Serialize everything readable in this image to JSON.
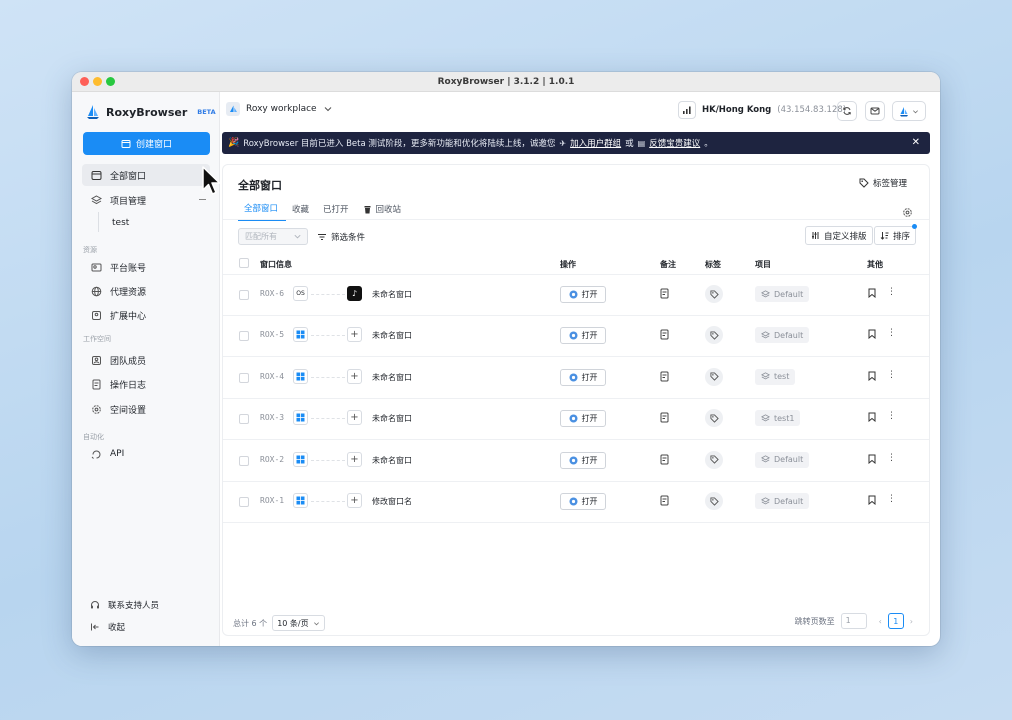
{
  "window": {
    "title": "RoxyBrowser | 3.1.2 | 1.0.1"
  },
  "brand": {
    "name": "RoxyBrowser",
    "badge": "BETA"
  },
  "sidebar": {
    "create_button": "创建窗口",
    "items": [
      {
        "label": "全部窗口"
      },
      {
        "label": "项目管理"
      },
      {
        "label": "平台账号"
      },
      {
        "label": "代理资源"
      },
      {
        "label": "扩展中心"
      },
      {
        "label": "团队成员"
      },
      {
        "label": "操作日志"
      },
      {
        "label": "空间设置"
      },
      {
        "label": "API"
      }
    ],
    "sub_item": "test",
    "sections": [
      "资源",
      "工作空间",
      "自动化"
    ],
    "support": "联系支持人员",
    "collapse": "收起"
  },
  "topbar": {
    "workspace": "Roxy workplace",
    "proxy_location": "HK/Hong Kong",
    "proxy_ip": "(43.154.83.128)"
  },
  "banner": {
    "text": "RoxyBrowser 目前已进入 Beta 测试阶段，更多新功能和优化将陆续上线，诚邀您",
    "link1": "加入用户群组",
    "or": "或",
    "link2": "反馈宝贵建议",
    "end": "。"
  },
  "main": {
    "title": "全部窗口",
    "tag_mgmt": "标签管理",
    "tabs": [
      "全部窗口",
      "收藏",
      "已打开",
      "回收站"
    ],
    "filter_placeholder": "匹配所有",
    "filter_conditions": "筛选条件",
    "custom_columns": "自定义排版",
    "sort": "排序",
    "columns": [
      "窗口信息",
      "操作",
      "备注",
      "标签",
      "项目",
      "其他"
    ],
    "open_label": "打开",
    "rows": [
      {
        "id": "ROX-6",
        "os": "OS",
        "platform": "tiktok",
        "name": "未命名窗口",
        "project": "Default"
      },
      {
        "id": "ROX-5",
        "os": "win",
        "platform": "plus",
        "name": "未命名窗口",
        "project": "Default"
      },
      {
        "id": "ROX-4",
        "os": "win",
        "platform": "plus",
        "name": "未命名窗口",
        "project": "test"
      },
      {
        "id": "ROX-3",
        "os": "win",
        "platform": "plus",
        "name": "未命名窗口",
        "project": "test1"
      },
      {
        "id": "ROX-2",
        "os": "win",
        "platform": "plus",
        "name": "未命名窗口",
        "project": "Default"
      },
      {
        "id": "ROX-1",
        "os": "win",
        "platform": "plus",
        "name": "修改窗口名",
        "project": "Default"
      }
    ],
    "total": "总计 6 个",
    "page_size": "10 条/页",
    "jump_label": "跳转页数至",
    "jump_value": "1",
    "current_page": "1"
  },
  "colors": {
    "accent": "#1a8cf5",
    "banner_bg": "#1e2440"
  }
}
